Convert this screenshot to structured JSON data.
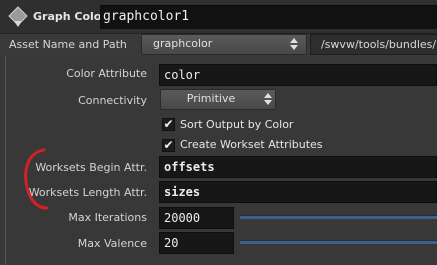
{
  "header": {
    "node_type": "Graph Color",
    "node_name": "graphcolor1"
  },
  "asset": {
    "label": "Asset Name and Path",
    "name": "graphcolor",
    "path": "/swvw/tools/bundles/hfs"
  },
  "params": {
    "color_attribute": {
      "label": "Color Attribute",
      "value": "color"
    },
    "connectivity": {
      "label": "Connectivity",
      "value": "Primitive"
    },
    "sort_output": {
      "label": "Sort Output by Color",
      "checked": true
    },
    "create_worksets": {
      "label": "Create Workset Attributes",
      "checked": true
    },
    "worksets_begin": {
      "label": "Worksets Begin Attr.",
      "value": "offsets"
    },
    "worksets_length": {
      "label": "Worksets Length Attr.",
      "value": "sizes"
    },
    "max_iterations": {
      "label": "Max Iterations",
      "value": "20000"
    },
    "max_valence": {
      "label": "Max Valence",
      "value": "20"
    }
  },
  "glyphs": {
    "check": "✔"
  },
  "icons": [
    "node-type-icon",
    "chevron-updown-icon",
    "checkmark-icon"
  ],
  "colors": {
    "panel_bg": "#383838",
    "field_bg": "#171717",
    "slider": "#3f5f86",
    "annotation": "#d0202a"
  }
}
